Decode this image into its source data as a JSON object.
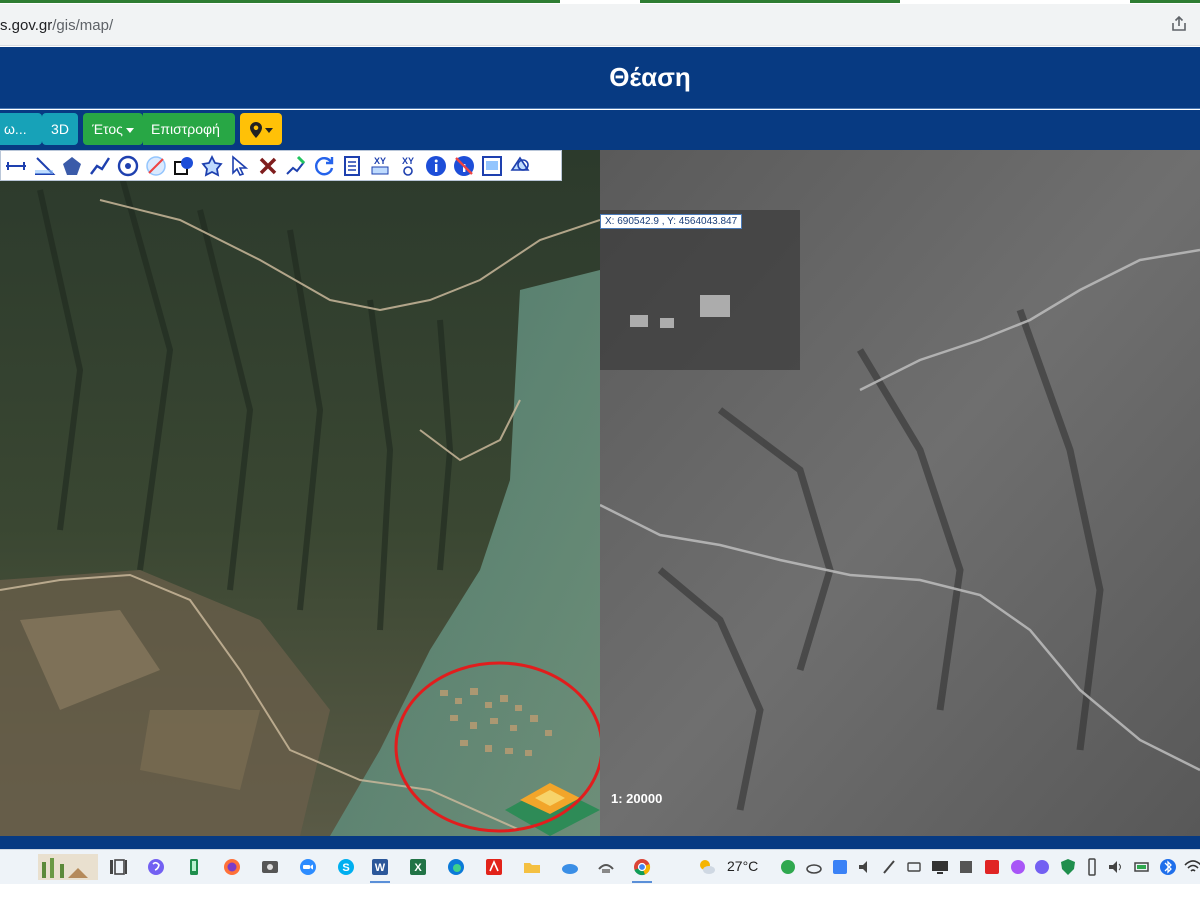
{
  "browser": {
    "url_domain": "s.gov.gr",
    "url_path": "/gis/map/"
  },
  "header": {
    "title": "Θέαση"
  },
  "toolbar": {
    "view_dropdown_label": "ω...",
    "btn_3d_label": "3D",
    "year_dropdown_label": "Έτος",
    "return_label": "Επιστροφή"
  },
  "map": {
    "coordinates": "X: 690542.9 , Y: 4564043.847",
    "scale": "1: 20000"
  },
  "drawing_tools": [
    "measure-distance-icon",
    "measure-angle-icon",
    "polygon-icon",
    "polyline-icon",
    "circle-icon",
    "erase-shape-icon",
    "fill-shape-icon",
    "star-polygon-icon",
    "select-arrow-icon",
    "delete-icon",
    "edit-vertices-icon",
    "refresh-icon",
    "document-icon",
    "xy-coordinates-icon",
    "xy-goto-icon",
    "info-icon",
    "no-info-icon",
    "print-icon",
    "layers-icon"
  ],
  "taskbar": {
    "temperature": "27°C"
  },
  "colors": {
    "header_blue": "#073a82",
    "teal": "#17a2b8",
    "green": "#28a745",
    "yellow": "#ffc107",
    "highlight_circle": "#e11d1d"
  }
}
